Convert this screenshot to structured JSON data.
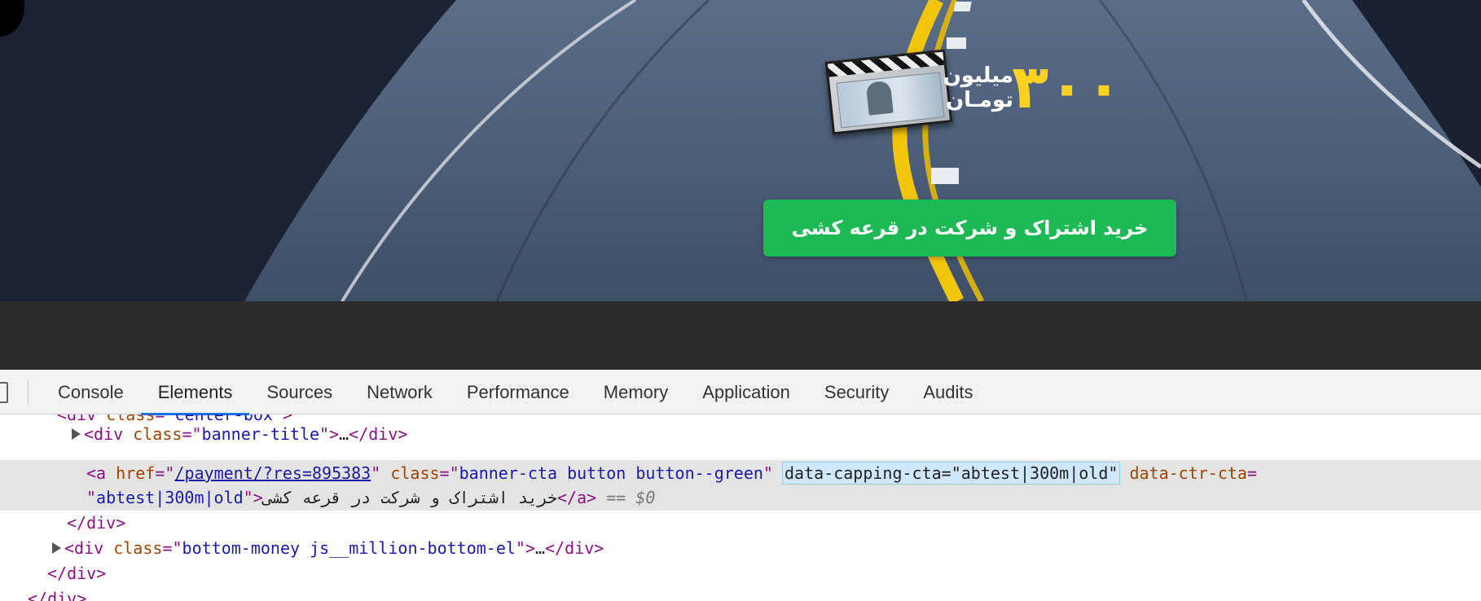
{
  "banner": {
    "prize_amount": "۳۰۰",
    "prize_unit_line1": "میلیون",
    "prize_unit_line2": "تومـان",
    "cta_label": "خرید اشتراک و شرکت در قرعه کشی"
  },
  "devtools": {
    "tabs": [
      {
        "label": "Console"
      },
      {
        "label": "Elements"
      },
      {
        "label": "Sources"
      },
      {
        "label": "Network"
      },
      {
        "label": "Performance"
      },
      {
        "label": "Memory"
      },
      {
        "label": "Application"
      },
      {
        "label": "Security"
      },
      {
        "label": "Audits"
      }
    ],
    "active_tab": "Elements",
    "tree": {
      "cut_line": {
        "tag_open": "<div",
        "attr": "class",
        "value": "center-box"
      },
      "banner_title": {
        "tag": "div",
        "attr": "class",
        "value": "banner-title",
        "ellipsis": "…"
      },
      "cta_anchor": {
        "tag": "a",
        "href_attr": "href",
        "href_value": "/payment/?res=895383",
        "class_attr": "class",
        "class_value": "banner-cta button button--green",
        "capping_attr_full": "data-capping-cta=\"abtest|300m|old\"",
        "ctr_attr": "data-ctr-cta",
        "ctr_value": "abtest|300m|old",
        "text": "خرید اشتراک و شرکت در قرعه کشی",
        "console_ref": "== $0"
      },
      "close_div_1": "</div>",
      "bottom_money": {
        "tag": "div",
        "attr": "class",
        "value": "bottom-money js__million-bottom-el",
        "ellipsis": "…"
      },
      "close_div_2": "</div>",
      "close_div_3": "</div>"
    }
  }
}
